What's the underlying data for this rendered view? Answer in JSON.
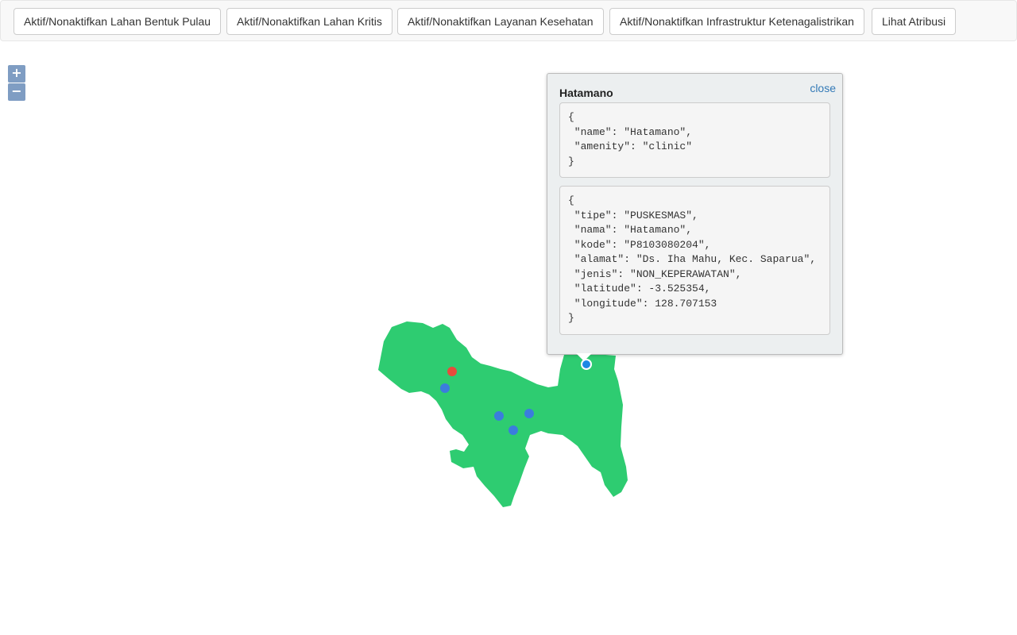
{
  "toolbar": {
    "buttons": [
      {
        "label": "Aktif/Nonaktifkan Lahan Bentuk Pulau"
      },
      {
        "label": "Aktif/Nonaktifkan Lahan Kritis"
      },
      {
        "label": "Aktif/Nonaktifkan Layanan Kesehatan"
      },
      {
        "label": "Aktif/Nonaktifkan Infrastruktur Ketenagalistrikan"
      },
      {
        "label": "Lihat Atribusi"
      }
    ]
  },
  "zoom": {
    "in_label": "+",
    "out_label": "−"
  },
  "popup": {
    "title": "Hatamano",
    "close_label": "close",
    "osm_json": "{\n \"name\": \"Hatamano\",\n \"amenity\": \"clinic\"\n}",
    "detail_json": "{\n \"tipe\": \"PUSKESMAS\",\n \"nama\": \"Hatamano\",\n \"kode\": \"P8103080204\",\n \"alamat\": \"Ds. Iha Mahu, Kec. Saparua\",\n \"jenis\": \"NON_KEPERAWATAN\",\n \"latitude\": -3.525354,\n \"longitude\": 128.707153\n}"
  },
  "map": {
    "island_color": "#2ecc71",
    "health_marker_color": "#3b7ddd",
    "electric_marker_color": "#e74c3c",
    "selected_marker_color": "#1e88e5"
  }
}
